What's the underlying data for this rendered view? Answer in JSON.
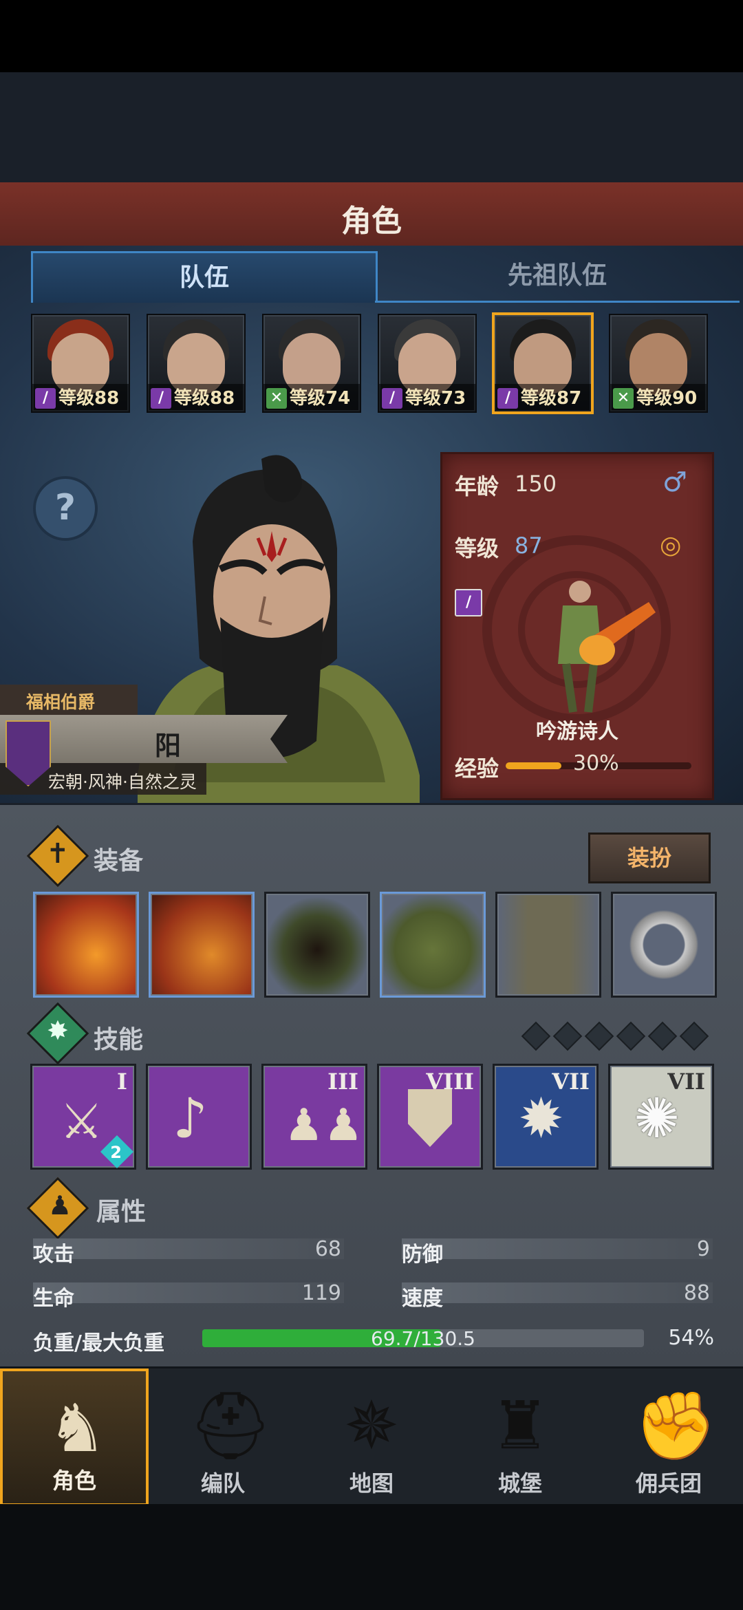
{
  "header": {
    "title": "角色"
  },
  "tabs": [
    {
      "label": "队伍"
    },
    {
      "label": "先祖队伍"
    }
  ],
  "party": [
    {
      "level": "等级88",
      "class_icon": "staff-icon"
    },
    {
      "level": "等级88",
      "class_icon": "staff-icon"
    },
    {
      "level": "等级74",
      "class_icon": "bow-icon"
    },
    {
      "level": "等级73",
      "class_icon": "staff-icon"
    },
    {
      "level": "等级87",
      "class_icon": "staff-icon",
      "selected": true
    },
    {
      "level": "等级90",
      "class_icon": "bow-icon"
    }
  ],
  "character": {
    "noble_title": "福相伯爵",
    "name": "阳",
    "traits": "宏朝·风神·自然之灵",
    "age_label": "年龄",
    "age": "150",
    "level_label": "等级",
    "level": "87",
    "class_name": "吟游诗人",
    "exp_label": "经验",
    "exp_percent": "30%",
    "exp_fraction": 0.3,
    "gender_icon": "male-icon",
    "status_icon": "ring-icon"
  },
  "equipment": {
    "title": "装备",
    "dress_button": "装扮",
    "slots": [
      "lute-weapon-icon",
      "lute-weapon-icon",
      "hood-icon",
      "tunic-icon",
      "boots-icon",
      "ring-icon"
    ]
  },
  "skills": {
    "title": "技能",
    "slots_total": 6,
    "items": [
      {
        "icon": "dagger-skill-icon",
        "rank": "I",
        "badge": "2"
      },
      {
        "icon": "crystal-note-icon",
        "rank": ""
      },
      {
        "icon": "party-buff-icon",
        "rank": "III"
      },
      {
        "icon": "shield-skill-icon",
        "rank": "VIII"
      },
      {
        "icon": "burst-skill-icon",
        "rank": "VII"
      },
      {
        "icon": "shatter-skill-icon",
        "rank": "VII"
      }
    ]
  },
  "attributes": {
    "title": "属性",
    "attack_label": "攻击",
    "attack": "68",
    "defense_label": "防御",
    "defense": "9",
    "hp_label": "生命",
    "hp": "119",
    "speed_label": "速度",
    "speed": "88",
    "load_label": "负重/最大负重",
    "load": "69.7/130.5",
    "load_percent": "54%",
    "load_fraction": 0.54
  },
  "nav": [
    {
      "label": "角色",
      "icon": "knight-icon",
      "active": true
    },
    {
      "label": "编队",
      "icon": "helmet-icon"
    },
    {
      "label": "地图",
      "icon": "compass-icon"
    },
    {
      "label": "城堡",
      "icon": "castle-icon"
    },
    {
      "label": "佣兵团",
      "icon": "fist-icon"
    }
  ],
  "colors": {
    "accent": "#f0a51e",
    "header": "#6e2c25",
    "tab_border": "#3f86c6",
    "load_bar": "#2fae3a"
  }
}
